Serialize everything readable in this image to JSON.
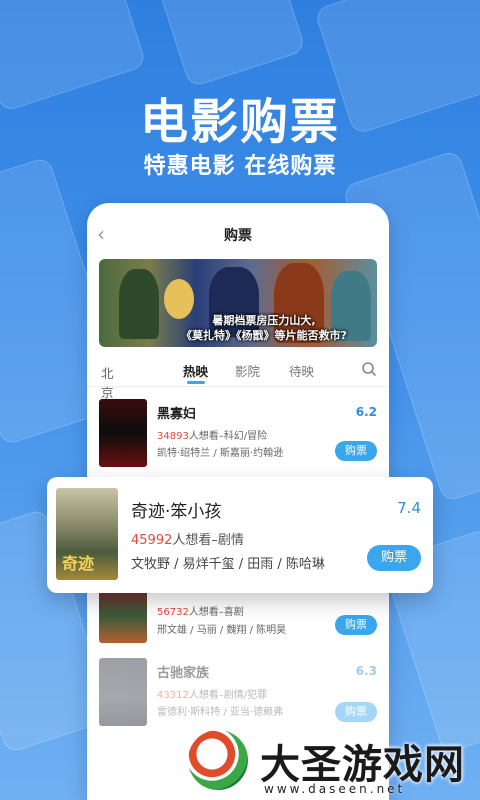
{
  "hero": {
    "title": "电影购票",
    "subtitle": "特惠电影 在线购票"
  },
  "phone": {
    "title": "购票",
    "banner_text_line1": "暑期档票房压力山大,",
    "banner_text_line2": "《莫扎特》《杨戬》等片能否救市?",
    "city": "北京",
    "tabs": [
      "热映",
      "影院",
      "待映"
    ],
    "movies": [
      {
        "title": "黑寡妇",
        "score": "6.2",
        "want_count": "34893",
        "want_text": "人想看–科幻/冒险",
        "cast": "凯特·绍特兰 / 斯嘉丽·约翰逊",
        "buy": "购票"
      },
      {
        "title": "",
        "score": "",
        "want_count": "56732",
        "want_text": "人想看–喜剧",
        "cast": "邢文雄 / 马丽 / 魏翔 / 陈明昊",
        "buy": "购票"
      },
      {
        "title": "古驰家族",
        "score": "6.3",
        "want_count": "43312",
        "want_text": "人想看–剧情/犯罪",
        "cast": "雷德利·斯科特 / 亚当·德赖弗",
        "buy": "购票"
      }
    ]
  },
  "featured": {
    "title": "奇迹·笨小孩",
    "score": "7.4",
    "want_count": "45992",
    "want_text": "人想看–剧情",
    "cast": "文牧野 / 易烊千玺 / 田雨 / 陈哈琳",
    "buy": "购票",
    "poster_text": "奇迹"
  },
  "watermark": {
    "text": "大圣游戏网",
    "url": "www.daseen.net"
  },
  "colors": {
    "accent": "#3aa6ee",
    "want_count": "#e8473e",
    "score": "#2d8fdc",
    "background": "#2f7fe0"
  }
}
